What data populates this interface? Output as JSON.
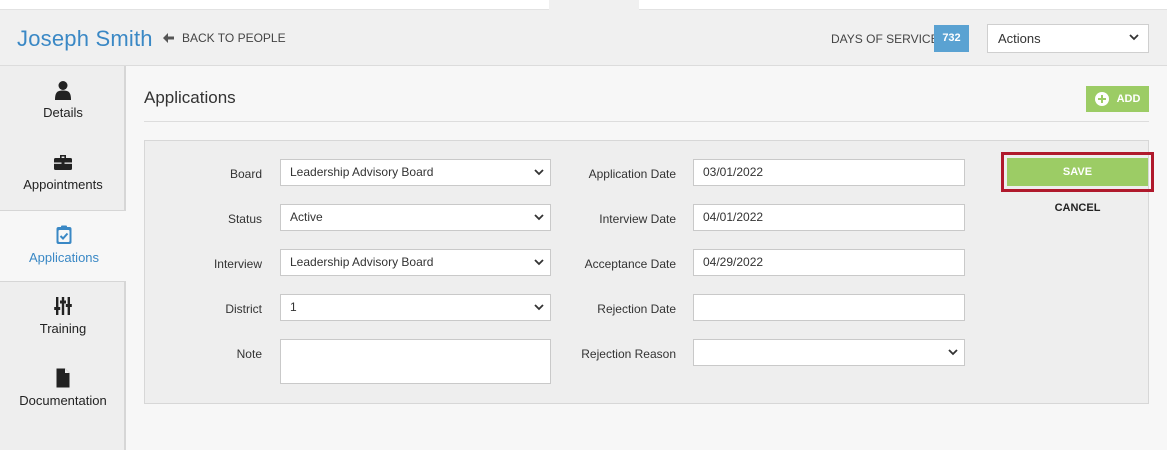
{
  "header": {
    "person_name": "Joseph Smith",
    "back_label": "BACK TO PEOPLE",
    "days_label": "DAYS OF SERVICE",
    "days_value": "732",
    "actions_select": {
      "value": "Actions"
    }
  },
  "sidebar": {
    "items": [
      {
        "label": "Details",
        "icon": "person-icon"
      },
      {
        "label": "Appointments",
        "icon": "briefcase-icon"
      },
      {
        "label": "Applications",
        "icon": "clipboard-check-icon",
        "active": true
      },
      {
        "label": "Training",
        "icon": "sliders-icon"
      },
      {
        "label": "Documentation",
        "icon": "document-icon"
      }
    ]
  },
  "main": {
    "title": "Applications",
    "add_label": "ADD",
    "form": {
      "board": {
        "label": "Board",
        "value": "Leadership Advisory Board"
      },
      "status": {
        "label": "Status",
        "value": "Active"
      },
      "interview": {
        "label": "Interview",
        "value": "Leadership Advisory Board"
      },
      "district": {
        "label": "District",
        "value": "1"
      },
      "note": {
        "label": "Note",
        "value": ""
      },
      "application_date": {
        "label": "Application Date",
        "value": "03/01/2022"
      },
      "interview_date": {
        "label": "Interview Date",
        "value": "04/01/2022"
      },
      "acceptance_date": {
        "label": "Acceptance Date",
        "value": "04/29/2022"
      },
      "rejection_date": {
        "label": "Rejection Date",
        "value": ""
      },
      "rejection_reason": {
        "label": "Rejection Reason",
        "value": ""
      }
    },
    "save_label": "SAVE",
    "cancel_label": "CANCEL"
  },
  "colors": {
    "accent_blue": "#3a88c5",
    "badge_blue": "#5aa2d2",
    "button_green": "#9ccc65",
    "highlight_red": "#b0192c"
  }
}
